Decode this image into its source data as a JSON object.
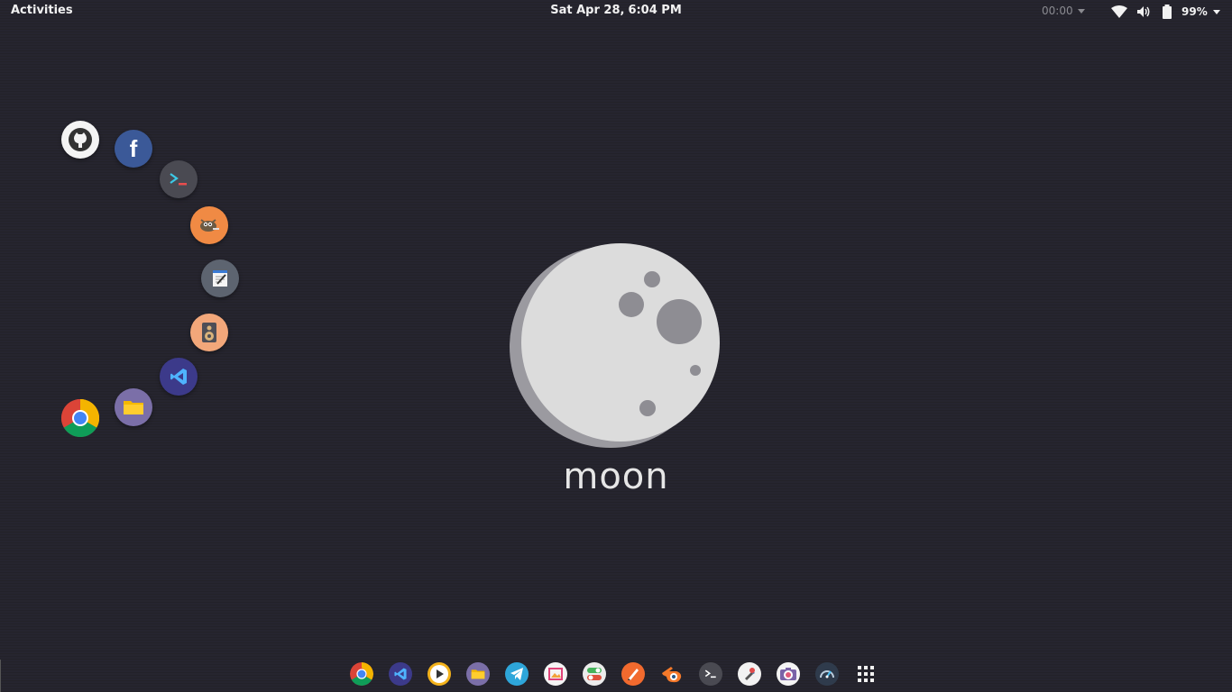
{
  "topbar": {
    "activities_label": "Activities",
    "date": "Sat Apr 28,",
    "time": "6:04 PM",
    "timer": "00:00",
    "battery_percent": "99%"
  },
  "desktop": {
    "logo_text": "moon"
  },
  "launcher_icons": [
    "github-icon",
    "facebook-icon",
    "terminal-icon",
    "gimp-icon",
    "text-editor-icon",
    "speaker-icon",
    "vscode-icon",
    "files-icon",
    "chrome-icon"
  ],
  "dock_icons": [
    "chrome-icon",
    "vscode-icon",
    "media-player-icon",
    "files-icon",
    "telegram-icon",
    "image-viewer-icon",
    "settings-toggle-icon",
    "inkscape-icon",
    "blender-icon",
    "terminal-icon",
    "tool-icon",
    "camera-icon",
    "speedometer-icon",
    "app-grid-icon"
  ],
  "colors": {
    "background": "#26252f",
    "moon": "#dcdcdc",
    "moon_shadow": "#9b9aa0",
    "crater": "#8e8d93"
  }
}
